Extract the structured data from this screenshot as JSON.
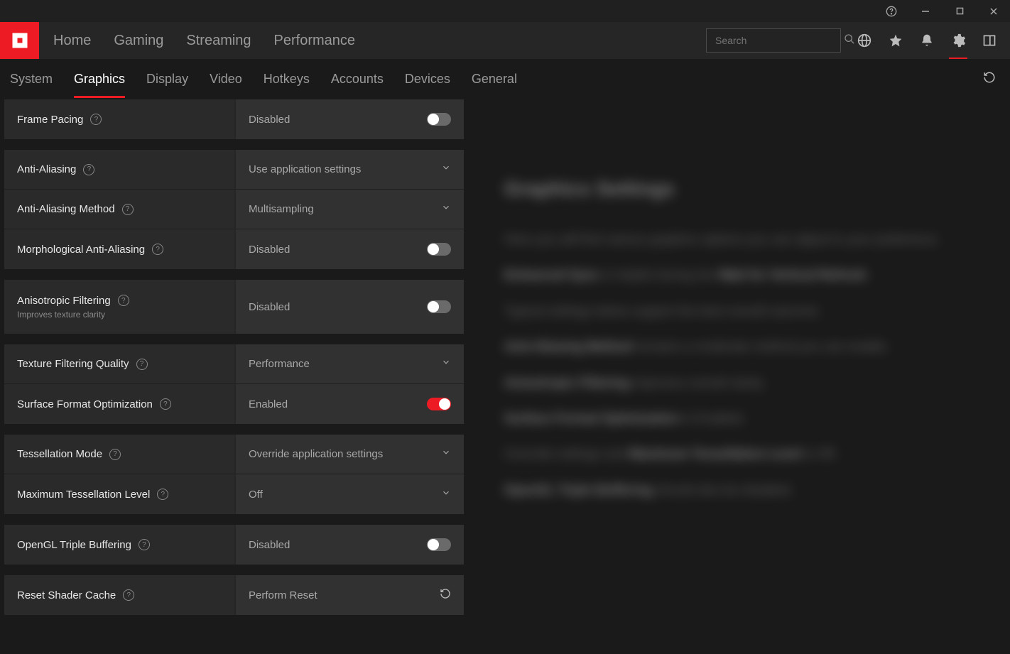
{
  "titlebar": {
    "help": "?",
    "min": "—",
    "max": "▢",
    "close": "✕"
  },
  "nav": {
    "items": [
      "Home",
      "Gaming",
      "Streaming",
      "Performance"
    ],
    "search_placeholder": "Search"
  },
  "subnav": {
    "items": [
      "System",
      "Graphics",
      "Display",
      "Video",
      "Hotkeys",
      "Accounts",
      "Devices",
      "General"
    ],
    "active": "Graphics"
  },
  "settings": {
    "frame_pacing": {
      "label": "Frame Pacing",
      "value": "Disabled",
      "on": false
    },
    "anti_aliasing": {
      "label": "Anti-Aliasing",
      "value": "Use application settings"
    },
    "aa_method": {
      "label": "Anti-Aliasing Method",
      "value": "Multisampling"
    },
    "morph_aa": {
      "label": "Morphological Anti-Aliasing",
      "value": "Disabled",
      "on": false
    },
    "aniso": {
      "label": "Anisotropic Filtering",
      "sub": "Improves texture clarity",
      "value": "Disabled",
      "on": false
    },
    "tex_filter": {
      "label": "Texture Filtering Quality",
      "value": "Performance"
    },
    "surf_fmt": {
      "label": "Surface Format Optimization",
      "value": "Enabled",
      "on": true
    },
    "tess_mode": {
      "label": "Tessellation Mode",
      "value": "Override application settings"
    },
    "max_tess": {
      "label": "Maximum Tessellation Level",
      "value": "Off"
    },
    "ogl_triple": {
      "label": "OpenGL Triple Buffering",
      "value": "Disabled",
      "on": false
    },
    "reset_shader": {
      "label": "Reset Shader Cache",
      "value": "Perform Reset"
    }
  },
  "right_panel": {
    "heading": "Graphics Settings",
    "p1": "Here you will find various graphics options you can adjust to your preference.",
    "p2": "Enhanced Sync is helpful during low Wait for Vertical Refresh.",
    "p3": "Typical settings below support the best overall outcome.",
    "p4": "Anti-Aliasing Method remains a moderate method you can enable.",
    "p5": "Anisotropic Filtering improves overall clarity.",
    "p6": "Surface Format Optimization is Enabled.",
    "p7": "Override settings and Maximum Tessellation Level is Off.",
    "p8": "OpenGL Triple Buffering should also be disabled."
  }
}
